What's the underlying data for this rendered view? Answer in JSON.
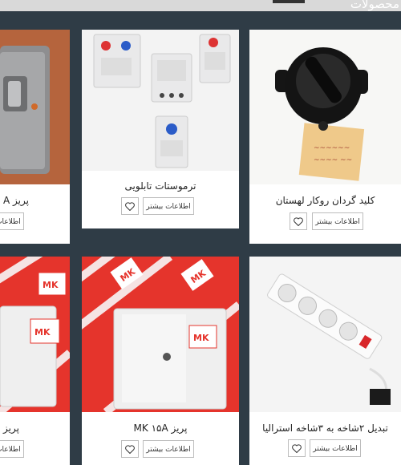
{
  "header": {
    "section_title": "محصولات"
  },
  "buttons": {
    "more_info": "اطلاعات بیشتر"
  },
  "products": [
    {
      "name": "کلید گردان روکار لهستان"
    },
    {
      "name": "ترموستات تابلویی"
    },
    {
      "name": "پریز A"
    },
    {
      "name": "تبدیل ۲شاخه به ۳شاخه استرالیا"
    },
    {
      "name": "پریز MK ۱۵A"
    },
    {
      "name": "پریز"
    }
  ],
  "colors": {
    "page_bg": "#2f3c46",
    "card_bg": "#ffffff",
    "mk_red": "#e5342c"
  }
}
